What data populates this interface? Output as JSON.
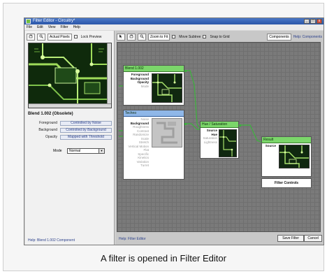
{
  "window": {
    "title": "Filter Editor - Circuitry*",
    "controls": [
      "_",
      "□",
      "x"
    ]
  },
  "menu": [
    "File",
    "Edit",
    "View",
    "Filter",
    "Help"
  ],
  "left_toolbar": {
    "actual_pixels": "Actual Pixels",
    "lock_preview": "Lock Preview"
  },
  "properties": {
    "title": "Blend 1.002 (Obsolete)",
    "rows": [
      {
        "label": "Foreground",
        "value": "Controlled by Noise"
      },
      {
        "label": "Background",
        "value": "Controlled by Background"
      },
      {
        "label": "Opacity",
        "value": "Mapped with Threshold"
      }
    ],
    "mode_label": "Mode",
    "mode_value": "Normal",
    "help": "Help: Blend 1.002 Component"
  },
  "canvas_toolbar": {
    "zoom_to_fit": "Zoom to Fit",
    "move_subtree": "Move Subtree",
    "snap_to_grid": "Snap to Grid",
    "components": "Components",
    "help_components": "Help: Components"
  },
  "nodes": {
    "blend": {
      "title": "Blend 1.002",
      "ports": [
        "Foreground",
        "Background",
        "Opacity",
        "Mode"
      ]
    },
    "techno": {
      "title": "Techno",
      "ports": [
        "Noise",
        "Background",
        "Roughness",
        "Contrast",
        "Randomize",
        "Scale",
        "Stretch",
        "Vertical Motion",
        "Flat",
        "Specific",
        "Kinetics",
        "Variation",
        "Turret"
      ]
    },
    "huesat": {
      "title": "Hue / Saturation",
      "ports": [
        "Source",
        "Hue",
        "Saturation",
        "Lightness"
      ]
    },
    "result": {
      "title": "Result",
      "ports": [
        "Source"
      ],
      "filter_controls": "Filter Controls"
    }
  },
  "bottom": {
    "help": "Help: Filter Editor",
    "save": "Save Filter",
    "cancel": "Cancel"
  },
  "caption": "A filter is opened in Filter Editor"
}
